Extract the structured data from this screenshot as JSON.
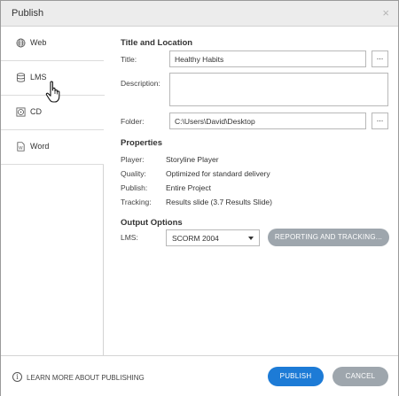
{
  "window": {
    "title": "Publish",
    "close_glyph": "×"
  },
  "sidebar": {
    "items": [
      {
        "label": "Web",
        "icon": "globe-icon",
        "active": false
      },
      {
        "label": "LMS",
        "icon": "database-icon",
        "active": true
      },
      {
        "label": "CD",
        "icon": "disc-icon",
        "active": false
      },
      {
        "label": "Word",
        "icon": "document-icon",
        "active": false
      }
    ]
  },
  "title_location": {
    "heading": "Title and Location",
    "title_label": "Title:",
    "title_value": "Healthy Habits",
    "description_label": "Description:",
    "description_value": "",
    "folder_label": "Folder:",
    "folder_value": "C:\\Users\\David\\Desktop",
    "browse_label": "..."
  },
  "properties": {
    "heading": "Properties",
    "rows": [
      {
        "label": "Player:",
        "value": "Storyline Player"
      },
      {
        "label": "Quality:",
        "value": "Optimized for standard delivery"
      },
      {
        "label": "Publish:",
        "value": "Entire Project"
      },
      {
        "label": "Tracking:",
        "value": "Results slide (3.7 Results Slide)"
      }
    ]
  },
  "output_options": {
    "heading": "Output Options",
    "lms_label": "LMS:",
    "lms_selected": "SCORM 2004",
    "reporting_button": "REPORTING AND TRACKING..."
  },
  "footer": {
    "info_glyph": "i",
    "learn_more": "LEARN MORE ABOUT PUBLISHING",
    "publish_button": "PUBLISH",
    "cancel_button": "CANCEL"
  },
  "colors": {
    "primary": "#1d7bd6",
    "secondary": "#9ea6ad",
    "titlebar": "#ececec"
  }
}
